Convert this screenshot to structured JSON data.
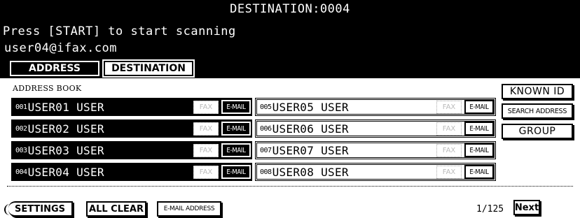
{
  "header": {
    "title": "DESTINATION:0004",
    "instruction": "Press [START] to start scanning",
    "recipient": "user04@ifax.com"
  },
  "tabs": {
    "address": "ADDRESS",
    "destination": "DESTINATION"
  },
  "address_book_label": "ADDRESS BOOK",
  "entries": [
    {
      "num": "001",
      "name": "USER01 USER",
      "selected": true,
      "fax": "FAX",
      "email": "E-MAIL"
    },
    {
      "num": "002",
      "name": "USER02 USER",
      "selected": true,
      "fax": "FAX",
      "email": "E-MAIL"
    },
    {
      "num": "003",
      "name": "USER03 USER",
      "selected": true,
      "fax": "FAX",
      "email": "E-MAIL"
    },
    {
      "num": "004",
      "name": "USER04 USER",
      "selected": true,
      "fax": "FAX",
      "email": "E-MAIL"
    },
    {
      "num": "005",
      "name": "USER05 USER",
      "selected": false,
      "fax": "FAX",
      "email": "E-MAIL"
    },
    {
      "num": "006",
      "name": "USER06 USER",
      "selected": false,
      "fax": "FAX",
      "email": "E-MAIL"
    },
    {
      "num": "007",
      "name": "USER07 USER",
      "selected": false,
      "fax": "FAX",
      "email": "E-MAIL"
    },
    {
      "num": "008",
      "name": "USER08 USER",
      "selected": false,
      "fax": "FAX",
      "email": "E-MAIL"
    }
  ],
  "side_buttons": {
    "known_id": "KNOWN ID",
    "search_address": "SEARCH ADDRESS",
    "group": "GROUP"
  },
  "footer": {
    "settings": "SETTINGS",
    "all_clear": "ALL CLEAR",
    "email_address": "E-MAIL ADDRESS",
    "page_indicator": "1/125",
    "next": "Next"
  }
}
